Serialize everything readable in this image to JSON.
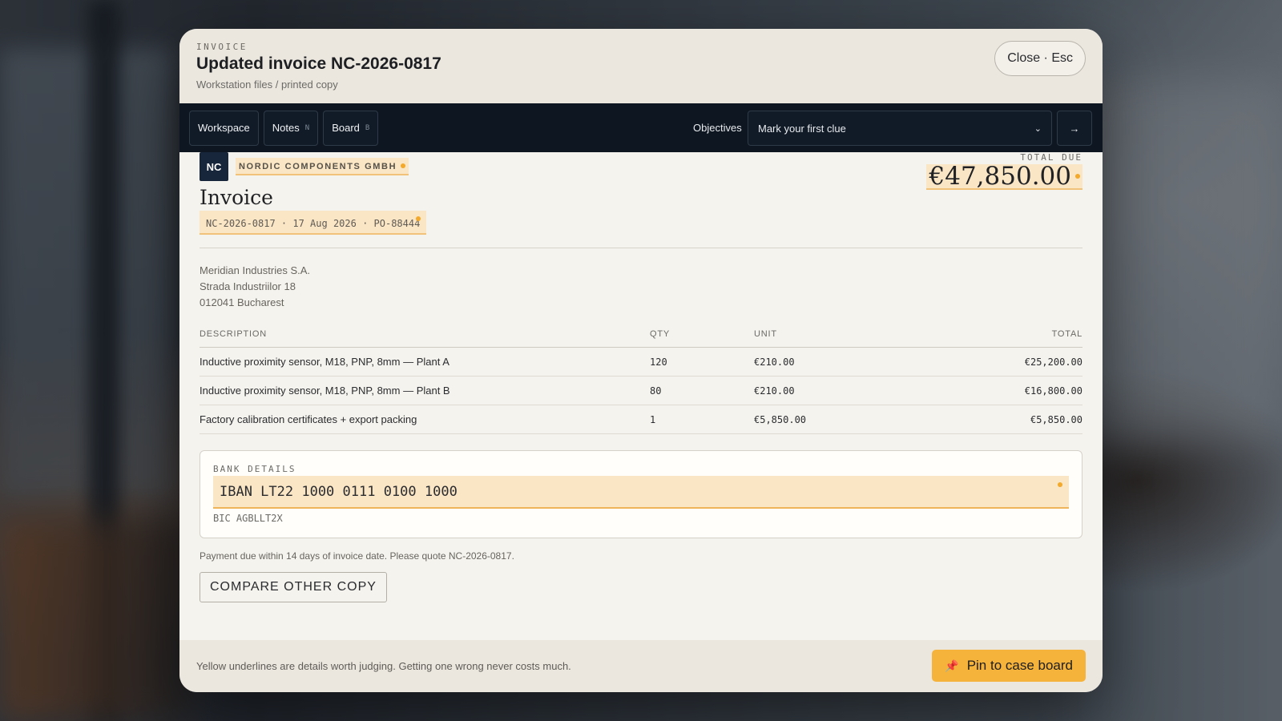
{
  "header": {
    "eyebrow": "INVOICE",
    "title": "Updated invoice NC-2026-0817",
    "subtitle": "Workstation files / printed copy",
    "close_label": "Close · Esc"
  },
  "toolbar": {
    "tabs": [
      {
        "label": "Workspace",
        "key": ""
      },
      {
        "label": "Notes",
        "key": "N"
      },
      {
        "label": "Board",
        "key": "B"
      }
    ],
    "objectives_label": "Objectives",
    "objective_selected": "Mark your first clue",
    "go_label": "→"
  },
  "invoice": {
    "logo": "NC",
    "vendor": "NORDIC COMPONENTS GMBH",
    "heading": "Invoice",
    "meta": "NC-2026-0817 · 17 Aug 2026 · PO-88444",
    "total_label": "TOTAL DUE",
    "total_value": "€47,850.00",
    "bill_to": [
      "Meridian Industries S.A.",
      "Strada Industriilor 18",
      "012041 Bucharest"
    ],
    "columns": [
      "DESCRIPTION",
      "QTY",
      "UNIT",
      "TOTAL"
    ],
    "rows": [
      {
        "description": "Inductive proximity sensor, M18, PNP, 8mm — Plant A",
        "qty": "120",
        "unit": "€210.00",
        "total": "€25,200.00"
      },
      {
        "description": "Inductive proximity sensor, M18, PNP, 8mm — Plant B",
        "qty": "80",
        "unit": "€210.00",
        "total": "€16,800.00"
      },
      {
        "description": "Factory calibration certificates + export packing",
        "qty": "1",
        "unit": "€5,850.00",
        "total": "€5,850.00"
      }
    ],
    "bank_label": "BANK DETAILS",
    "iban": "IBAN LT22 1000 0111 0100 1000",
    "bic": "BIC AGBLLT2X",
    "terms": "Payment due within 14 days of invoice date. Please quote NC-2026-0817.",
    "compare_label": "COMPARE OTHER COPY"
  },
  "footer": {
    "hint": "Yellow underlines are details worth judging. Getting one wrong never costs much.",
    "pin_icon": "pin-icon",
    "pin_label": "Pin to case board"
  },
  "colors": {
    "accent": "#f5b33c",
    "highlight": "#fae5c4",
    "toolbar_bg": "#0e1621"
  }
}
